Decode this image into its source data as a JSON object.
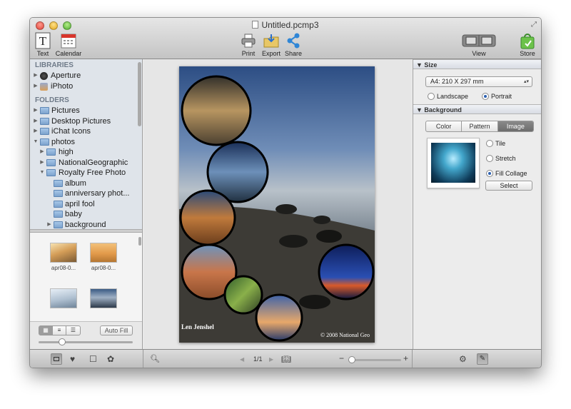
{
  "window": {
    "title": "Untitled.pcmp3"
  },
  "toolbar": {
    "text": "Text",
    "calendar": "Calendar",
    "print": "Print",
    "export": "Export",
    "share": "Share",
    "view": "View",
    "store": "Store"
  },
  "sidebar": {
    "libraries_header": "LIBRARIES",
    "libraries": [
      {
        "label": "Aperture"
      },
      {
        "label": "iPhoto"
      }
    ],
    "folders_header": "FOLDERS",
    "folders": [
      {
        "label": "Pictures"
      },
      {
        "label": "Desktop Pictures"
      },
      {
        "label": "iChat Icons"
      },
      {
        "label": "photos"
      },
      {
        "label": "high"
      },
      {
        "label": "NationalGeographic"
      },
      {
        "label": "Royalty Free Photo"
      },
      {
        "label": "album"
      },
      {
        "label": "anniversary phot..."
      },
      {
        "label": "april fool"
      },
      {
        "label": "baby"
      },
      {
        "label": "background"
      }
    ],
    "thumbnails": [
      {
        "label": "apr08-0..."
      },
      {
        "label": "apr08-0..."
      },
      {
        "label": ""
      },
      {
        "label": ""
      }
    ],
    "auto_fill": "Auto Fill"
  },
  "canvas": {
    "caption_left": "Len Jenshel",
    "caption_right": "© 2008 National Geo",
    "page_indicator": "1/1"
  },
  "inspector": {
    "size": {
      "header": "Size",
      "paper": "A4: 210 X 297 mm",
      "landscape": "Landscape",
      "portrait": "Portrait",
      "orientation": "Portrait"
    },
    "background": {
      "header": "Background",
      "tabs": [
        "Color",
        "Pattern",
        "Image"
      ],
      "active_tab": "Image",
      "options": [
        "Tile",
        "Stretch",
        "Fill Collage"
      ],
      "selected_option": "Fill Collage",
      "select_button": "Select"
    }
  },
  "colors": {
    "selection_radio": "#2a5fb0",
    "section_header": "#6f7b89",
    "sidebar_bg": "#dfe4ea"
  }
}
